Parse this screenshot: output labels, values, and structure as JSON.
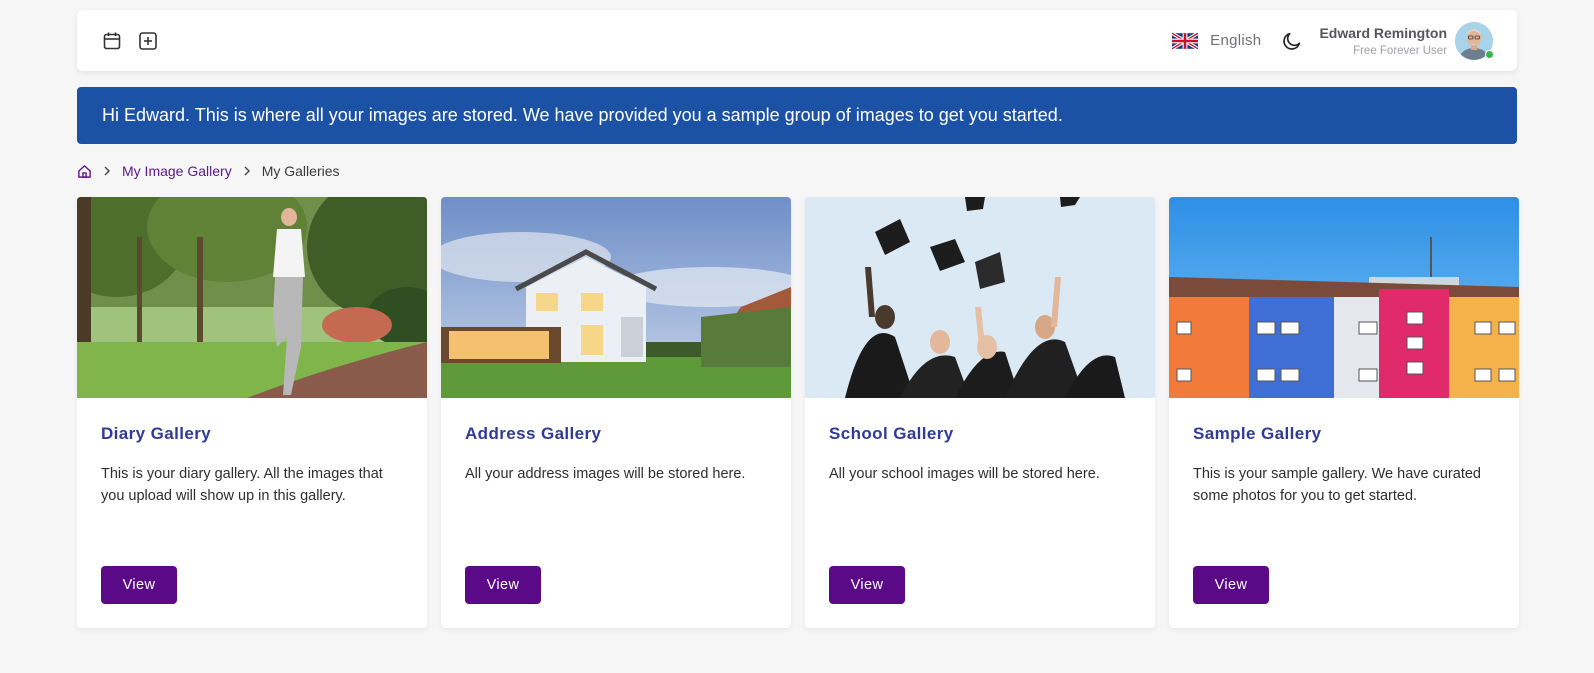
{
  "header": {
    "language": "English",
    "user_name": "Edward Remington",
    "user_plan": "Free Forever User"
  },
  "banner": {
    "message": "Hi Edward. This is where all your images are stored. We have provided you a sample group of images to get you started."
  },
  "breadcrumb": {
    "link": "My Image Gallery",
    "current": "My Galleries"
  },
  "galleries": [
    {
      "title": "Diary Gallery",
      "description": "This is your diary gallery. All the images that you upload will show up in this gallery.",
      "button": "View"
    },
    {
      "title": "Address Gallery",
      "description": "All your address images will be stored here.",
      "button": "View"
    },
    {
      "title": "School Gallery",
      "description": "All your school images will be stored here.",
      "button": "View"
    },
    {
      "title": "Sample Gallery",
      "description": "This is your sample gallery. We have curated some photos for you to get started.",
      "button": "View"
    }
  ],
  "colors": {
    "banner": "#1c52a5",
    "accent": "#5a0a86",
    "title": "#2f3a9a"
  }
}
